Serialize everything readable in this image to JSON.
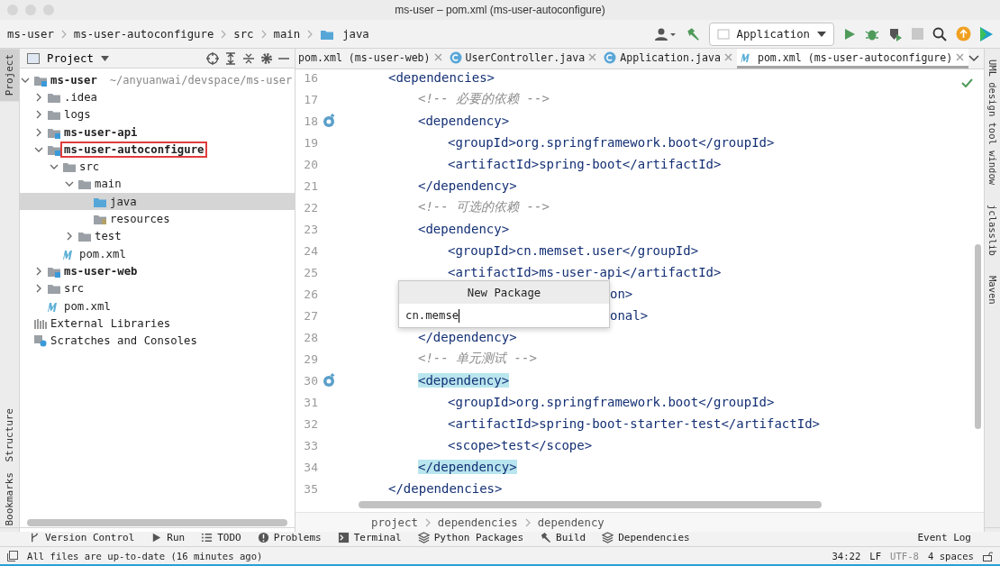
{
  "window": {
    "title": "ms-user – pom.xml (ms-user-autoconfigure)"
  },
  "breadcrumb": [
    "ms-user",
    "ms-user-autoconfigure",
    "src",
    "main",
    "java"
  ],
  "run_config": {
    "label": "Application"
  },
  "left_stripe": [
    {
      "label": "Project",
      "selected": true
    },
    {
      "label": "Structure",
      "selected": false
    },
    {
      "label": "Bookmarks",
      "selected": false
    }
  ],
  "right_stripe": [
    {
      "label": "UML design tool window"
    },
    {
      "label": "jclasslib"
    },
    {
      "label": "Maven"
    }
  ],
  "project_panel": {
    "title": "Project",
    "tree": [
      {
        "name": "ms-user",
        "kind": "module",
        "hint": "~/anyuanwai/devspace/ms-user",
        "expanded": true,
        "selected": false,
        "outlined": false,
        "children": [
          {
            "name": ".idea",
            "kind": "folder",
            "expanded": false,
            "selected": false,
            "outlined": false
          },
          {
            "name": "logs",
            "kind": "folder",
            "expanded": false,
            "selected": false,
            "outlined": false
          },
          {
            "name": "ms-user-api",
            "kind": "module",
            "expanded": false,
            "selected": false,
            "outlined": false
          },
          {
            "name": "ms-user-autoconfigure",
            "kind": "module",
            "expanded": true,
            "selected": false,
            "outlined": true,
            "children": [
              {
                "name": "src",
                "kind": "folder",
                "expanded": true,
                "selected": false,
                "outlined": false,
                "children": [
                  {
                    "name": "main",
                    "kind": "folder",
                    "expanded": true,
                    "selected": false,
                    "outlined": false,
                    "children": [
                      {
                        "name": "java",
                        "kind": "source",
                        "selected": true,
                        "outlined": false
                      },
                      {
                        "name": "resources",
                        "kind": "resources",
                        "selected": false,
                        "outlined": false
                      }
                    ]
                  },
                  {
                    "name": "test",
                    "kind": "folder",
                    "expanded": false,
                    "selected": false,
                    "outlined": false
                  }
                ]
              },
              {
                "name": "pom.xml",
                "kind": "maven",
                "selected": false,
                "outlined": false
              }
            ]
          },
          {
            "name": "ms-user-web",
            "kind": "module",
            "expanded": false,
            "selected": false,
            "outlined": false
          },
          {
            "name": "src",
            "kind": "folder",
            "expanded": false,
            "selected": false,
            "outlined": false
          },
          {
            "name": "pom.xml",
            "kind": "maven",
            "selected": false,
            "outlined": false
          }
        ]
      },
      {
        "name": "External Libraries",
        "kind": "libraries",
        "selected": false,
        "outlined": false
      },
      {
        "name": "Scratches and Consoles",
        "kind": "scratches",
        "selected": false,
        "outlined": false
      }
    ]
  },
  "editor": {
    "tabs": [
      {
        "label": "pom.xml (ms-user-web)",
        "kind": "plain",
        "selected": false
      },
      {
        "label": "UserController.java",
        "kind": "class",
        "selected": false
      },
      {
        "label": "Application.java",
        "kind": "class",
        "selected": false
      },
      {
        "label": "pom.xml (ms-user-autoconfigure)",
        "kind": "maven",
        "selected": true
      }
    ],
    "lines": [
      {
        "number": "16",
        "text": "<dependencies>",
        "kind": "code",
        "overridden": false,
        "matched": false,
        "children": [
          {
            "number": "17",
            "text": "<!-- 必要的依赖 -->",
            "kind": "comment",
            "overridden": false,
            "matched": false
          },
          {
            "number": "18",
            "text": "<dependency>",
            "kind": "code",
            "overridden": true,
            "matched": false,
            "children": [
              {
                "number": "19",
                "text": "<groupId>org.springframework.boot</groupId>",
                "kind": "code",
                "overridden": false,
                "matched": false
              },
              {
                "number": "20",
                "text": "<artifactId>spring-boot</artifactId>",
                "kind": "code",
                "overridden": false,
                "matched": false
              }
            ]
          },
          {
            "number": "21",
            "text": "</dependency>",
            "kind": "code",
            "overridden": false,
            "matched": false
          },
          {
            "number": "22",
            "text": "<!-- 可选的依赖 -->",
            "kind": "comment",
            "overridden": false,
            "matched": false
          },
          {
            "number": "23",
            "text": "<dependency>",
            "kind": "code",
            "overridden": false,
            "matched": false,
            "children": [
              {
                "number": "24",
                "text": "<groupId>cn.memset.user</groupId>",
                "kind": "code",
                "overridden": false,
                "matched": false
              },
              {
                "number": "25",
                "text": "<artifactId>ms-user-api</artifactId>",
                "kind": "code",
                "overridden": false,
                "matched": false
              },
              {
                "number": "26",
                "text": "on>",
                "kind": "tail",
                "overridden": false,
                "matched": false
              },
              {
                "number": "27",
                "text": "onal>",
                "kind": "tail",
                "overridden": false,
                "matched": false
              }
            ]
          },
          {
            "number": "28",
            "text": "</dependency>",
            "kind": "code",
            "overridden": false,
            "matched": false
          },
          {
            "number": "29",
            "text": "<!-- 单元测试 -->",
            "kind": "comment",
            "overridden": false,
            "matched": false
          },
          {
            "number": "30",
            "text": "<dependency>",
            "kind": "code",
            "overridden": true,
            "matched": true,
            "children": [
              {
                "number": "31",
                "text": "<groupId>org.springframework.boot</groupId>",
                "kind": "code",
                "overridden": false,
                "matched": false
              },
              {
                "number": "32",
                "text": "<artifactId>spring-boot-starter-test</artifactId>",
                "kind": "code",
                "overridden": false,
                "matched": false
              },
              {
                "number": "33",
                "text": "<scope>test</scope>",
                "kind": "code",
                "overridden": false,
                "matched": false
              }
            ]
          },
          {
            "number": "34",
            "text": "</dependency>",
            "kind": "code",
            "overridden": false,
            "matched": true
          }
        ]
      },
      {
        "number": "35",
        "text": "</dependencies>",
        "kind": "code",
        "overridden": false,
        "matched": false
      }
    ],
    "popup": {
      "title": "New Package",
      "value": "cn.memse"
    },
    "breadcrumb": [
      "project",
      "dependencies",
      "dependency"
    ]
  },
  "tool_windows": [
    {
      "label": "Version Control",
      "kind": "branch"
    },
    {
      "label": "Run",
      "kind": "play"
    },
    {
      "label": "TODO",
      "kind": "list"
    },
    {
      "label": "Problems",
      "kind": "alert"
    },
    {
      "label": "Terminal",
      "kind": "terminal"
    },
    {
      "label": "Python Packages",
      "kind": "layers"
    },
    {
      "label": "Build",
      "kind": "hammer"
    },
    {
      "label": "Dependencies",
      "kind": "layers"
    }
  ],
  "event_log": "Event Log",
  "status_bar": {
    "message": "All files are up-to-date (16 minutes ago)",
    "position": "34:22",
    "line_ending": "LF",
    "encoding": "UTF-8",
    "indent": "4 spaces"
  }
}
